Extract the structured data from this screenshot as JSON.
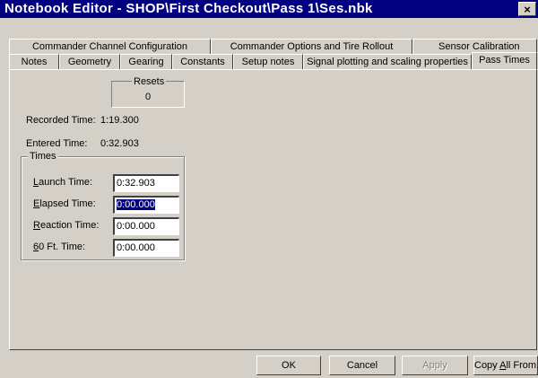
{
  "window": {
    "title": "Notebook Editor - SHOP\\First Checkout\\Pass 1\\Ses.nbk",
    "close_glyph": "×"
  },
  "tabs_row_top": [
    "Commander Channel Configuration",
    "Commander Options and Tire Rollout",
    "Sensor Calibration"
  ],
  "tabs_row_bottom": [
    "Notes",
    "Geometry",
    "Gearing",
    "Constants",
    "Setup notes",
    "Signal plotting and scaling properties",
    "Pass Times"
  ],
  "active_tab": "Pass Times",
  "resets": {
    "label": "Resets",
    "value": "0"
  },
  "recorded": {
    "label": "Recorded Time:",
    "value": "1:19.300"
  },
  "entered": {
    "label": "Entered Time:",
    "value": "0:32.903"
  },
  "times_group": {
    "label": "Times",
    "rows": [
      {
        "mnemonic": "L",
        "rest": "aunch Time:",
        "value": "0:32.903",
        "selected": false
      },
      {
        "mnemonic": "E",
        "rest": "lapsed Time:",
        "value": "0:00.000",
        "selected": true
      },
      {
        "mnemonic": "R",
        "rest": "eaction Time:",
        "value": "0:00.000",
        "selected": false
      },
      {
        "mnemonic": "6",
        "rest": "0 Ft. Time:",
        "value": "0:00.000",
        "selected": false
      }
    ]
  },
  "buttons": {
    "ok": "OK",
    "cancel": "Cancel",
    "apply": "Apply",
    "copy_pre": "Copy ",
    "copy_mnemonic": "A",
    "copy_post": "ll From..."
  }
}
